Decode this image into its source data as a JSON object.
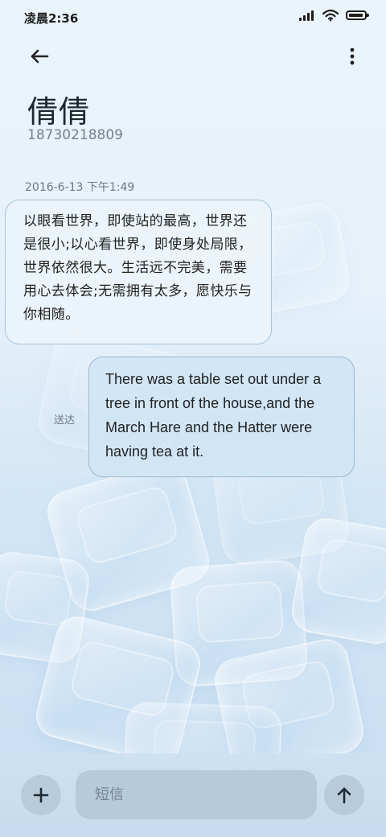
{
  "status_bar": {
    "time": "凌晨2:36"
  },
  "header": {
    "contact_name": "倩倩",
    "contact_number": "18730218809"
  },
  "conversation": {
    "timestamp": "2016-6-13 下午1:49",
    "incoming_message": "以眼看世界，即使站的最高，世界还是很小;以心看世界，即使身处局限，世界依然很大。生活远不完美，需要用心去体会;无需拥有太多，愿快乐与你相随。",
    "outgoing_message": "There was a table set out under a tree in front of the house,and the March Hare and the Hatter were having tea at it.",
    "outgoing_status": "送达"
  },
  "composer": {
    "placeholder": "短信"
  },
  "icons": {
    "back": "back-arrow-icon",
    "more": "more-vert-icon",
    "add": "plus-icon",
    "send": "send-arrow-up-icon",
    "signal": "signal-icon",
    "wifi": "wifi-icon",
    "battery": "battery-icon"
  },
  "colors": {
    "background": "#e6f1fa",
    "incoming_bubble": "#ecf4fa",
    "outgoing_bubble": "#d0e5f4",
    "input_bar": "#c8def1",
    "button_fill": "#b7cbdb"
  }
}
